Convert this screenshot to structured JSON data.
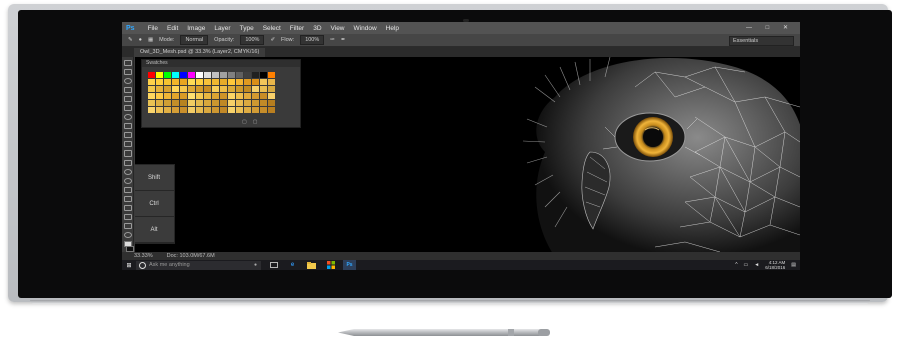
{
  "photoshop": {
    "app_icon": "Ps",
    "menu": [
      "File",
      "Edit",
      "Image",
      "Layer",
      "Type",
      "Select",
      "Filter",
      "3D",
      "View",
      "Window",
      "Help"
    ],
    "window_controls": "— □ ✕",
    "options": {
      "mode_label": "Mode:",
      "mode_value": "Normal",
      "opacity_label": "Opacity:",
      "opacity_value": "100%",
      "flow_label": "Flow:",
      "flow_value": "100%",
      "workspace": "Essentials"
    },
    "document_tab": "Owl_3D_Mesh.psd @ 33.3% (Layer2, CMYK/16)",
    "swatches_title": "Swatches",
    "swatch_colors": [
      "#ff0000",
      "#ffff00",
      "#00ff00",
      "#00ffff",
      "#0000ff",
      "#ff00ff",
      "#ffffff",
      "#e0e0e0",
      "#c0c0c0",
      "#a0a0a0",
      "#808080",
      "#606060",
      "#404040",
      "#202020",
      "#000000",
      "#ff8000",
      "#ffd24a",
      "#ffce3c",
      "#f5c330",
      "#f2b52a",
      "#e8a520",
      "#ffdd55",
      "#ffd040",
      "#f7c23a",
      "#f0b830",
      "#e7ab28",
      "#ffc83a",
      "#f3b532",
      "#e09a20",
      "#d98f18",
      "#f1c55a",
      "#e8b64a",
      "#f3c84a",
      "#e6b23a",
      "#d9a22e",
      "#ffd659",
      "#f5c84d",
      "#e0aa35",
      "#d49b2a",
      "#c98d22",
      "#f7cf5a",
      "#eebe48",
      "#ddab38",
      "#cf9a2c",
      "#c28b22",
      "#f4d06a",
      "#e8bd52",
      "#d7a940",
      "#ffd75e",
      "#ffcb45",
      "#f0b637",
      "#e2a52c",
      "#d89a25",
      "#ffdf70",
      "#f6cb52",
      "#e9b741",
      "#dca533",
      "#cf9428",
      "#fcd465",
      "#f0c04e",
      "#e2ab3c",
      "#d49a30",
      "#c88c26",
      "#f8d06a",
      "#e9c253",
      "#ddb042",
      "#d09f34",
      "#c38f29",
      "#b78220",
      "#f1cb62",
      "#e4b94d",
      "#d8a73c",
      "#cb972f",
      "#bf8825",
      "#f6cf68",
      "#eabc52",
      "#dcaa40",
      "#ce9931",
      "#c18a27",
      "#b57d1f",
      "#fad56d",
      "#efc255",
      "#e2b044",
      "#d59e36",
      "#c98f2b",
      "#f4cc66",
      "#e7ba50",
      "#daa83f",
      "#cd9731",
      "#c18827",
      "#f8d36b",
      "#ecc055",
      "#dfad43",
      "#d29c35",
      "#c68d2a",
      "#ba7f20"
    ],
    "modifier_keys": [
      "Shift",
      "Ctrl",
      "Alt"
    ],
    "status_zoom": "33.33%",
    "status_doc": "Doc: 103.0M/67.6M"
  },
  "taskbar": {
    "start_icon": "⊞",
    "search_placeholder": "Ask me anything",
    "mic_icon": "🎤",
    "apps": [
      "task-view",
      "edge",
      "file-explorer",
      "store",
      "photoshop"
    ],
    "ps_label": "Ps",
    "time": "4:12 AM",
    "date": "6/18/2016"
  }
}
